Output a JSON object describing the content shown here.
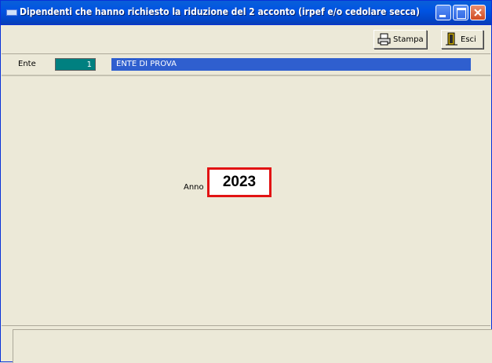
{
  "window": {
    "title": "Dipendenti che hanno richiesto la riduzione del 2 acconto (irpef e/o cedolare secca)"
  },
  "toolbar": {
    "stampa_label": "Stampa",
    "esci_label": "Esci"
  },
  "ente": {
    "label": "Ente",
    "code": "1",
    "name": "ENTE DI PROVA"
  },
  "form": {
    "anno_label": "Anno",
    "anno_value": "2023"
  },
  "colors": {
    "titlebar": "#0054E3",
    "ente_code_bg": "#008080",
    "ente_name_bg": "#2F5FCF",
    "highlight_border": "#E21313"
  }
}
